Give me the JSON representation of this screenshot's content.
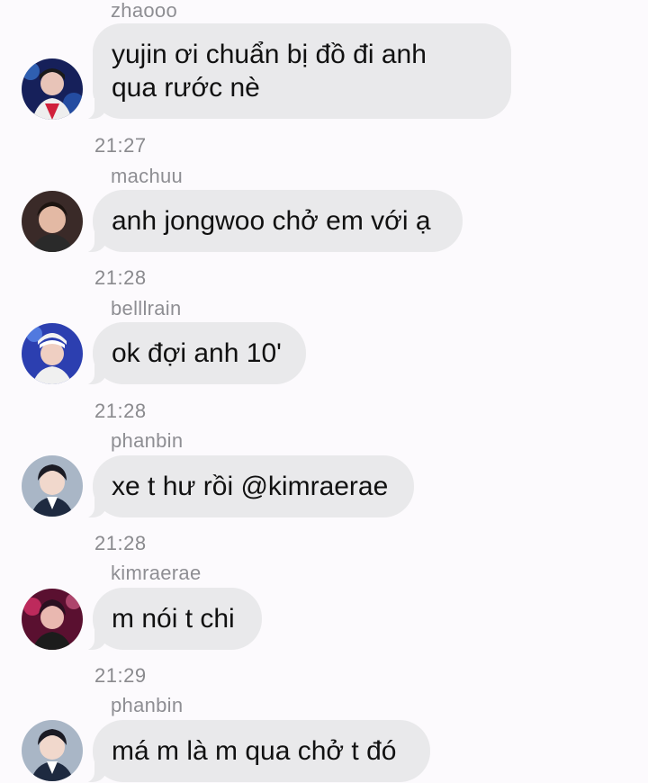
{
  "messages": [
    {
      "sender": "zhaooo",
      "text_line1": "yujin ơi chuẩn bị đồ đi anh",
      "text_line2": "qua rước nè",
      "time": "21:27",
      "avatar_color": "#1a2a66"
    },
    {
      "sender": "machuu",
      "text": "anh jongwoo chở em với ạ",
      "time": "21:28",
      "avatar_color": "#2a1e1e"
    },
    {
      "sender": "belllrain",
      "text": "ok đợi anh 10'",
      "time": "21:28",
      "avatar_color": "#2b3ea8"
    },
    {
      "sender": "phanbin",
      "text": "xe t hư rồi @kimraerae",
      "time": "21:28",
      "avatar_color": "#9aa8b8"
    },
    {
      "sender": "kimraerae",
      "text": "m nói t chi",
      "time": "21:29",
      "avatar_color": "#b0205a"
    },
    {
      "sender": "phanbin",
      "text": "má m là m qua chở t đó",
      "avatar_color": "#9aa8b8"
    }
  ]
}
